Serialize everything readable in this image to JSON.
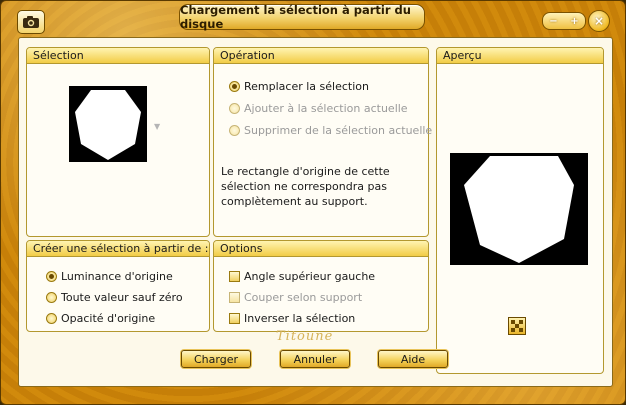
{
  "window": {
    "title": "Chargement la sélection à partir du disque"
  },
  "selection_group": {
    "title": "Sélection"
  },
  "operation_group": {
    "title": "Opération",
    "options": [
      {
        "label": "Remplacer la sélection",
        "checked": true,
        "enabled": true
      },
      {
        "label": "Ajouter à la sélection actuelle",
        "checked": false,
        "enabled": false
      },
      {
        "label": "Supprimer de la sélection actuelle",
        "checked": false,
        "enabled": false
      }
    ],
    "note": "Le rectangle d'origine de cette sélection ne correspondra pas complètement au support."
  },
  "preview_group": {
    "title": "Aperçu"
  },
  "create_group": {
    "title": "Créer une sélection à partir de :",
    "options": [
      {
        "label": "Luminance d'origine",
        "checked": true
      },
      {
        "label": "Toute valeur sauf zéro",
        "checked": false
      },
      {
        "label": "Opacité d'origine",
        "checked": false
      }
    ]
  },
  "options_group": {
    "title": "Options",
    "items": [
      {
        "label": "Angle supérieur gauche",
        "checked": false,
        "enabled": true
      },
      {
        "label": "Couper selon support",
        "checked": false,
        "enabled": false
      },
      {
        "label": "Inverser la sélection",
        "checked": false,
        "enabled": true
      }
    ]
  },
  "buttons": {
    "load": "Charger",
    "cancel": "Annuler",
    "help": "Aide"
  },
  "watermark": "Titoune"
}
